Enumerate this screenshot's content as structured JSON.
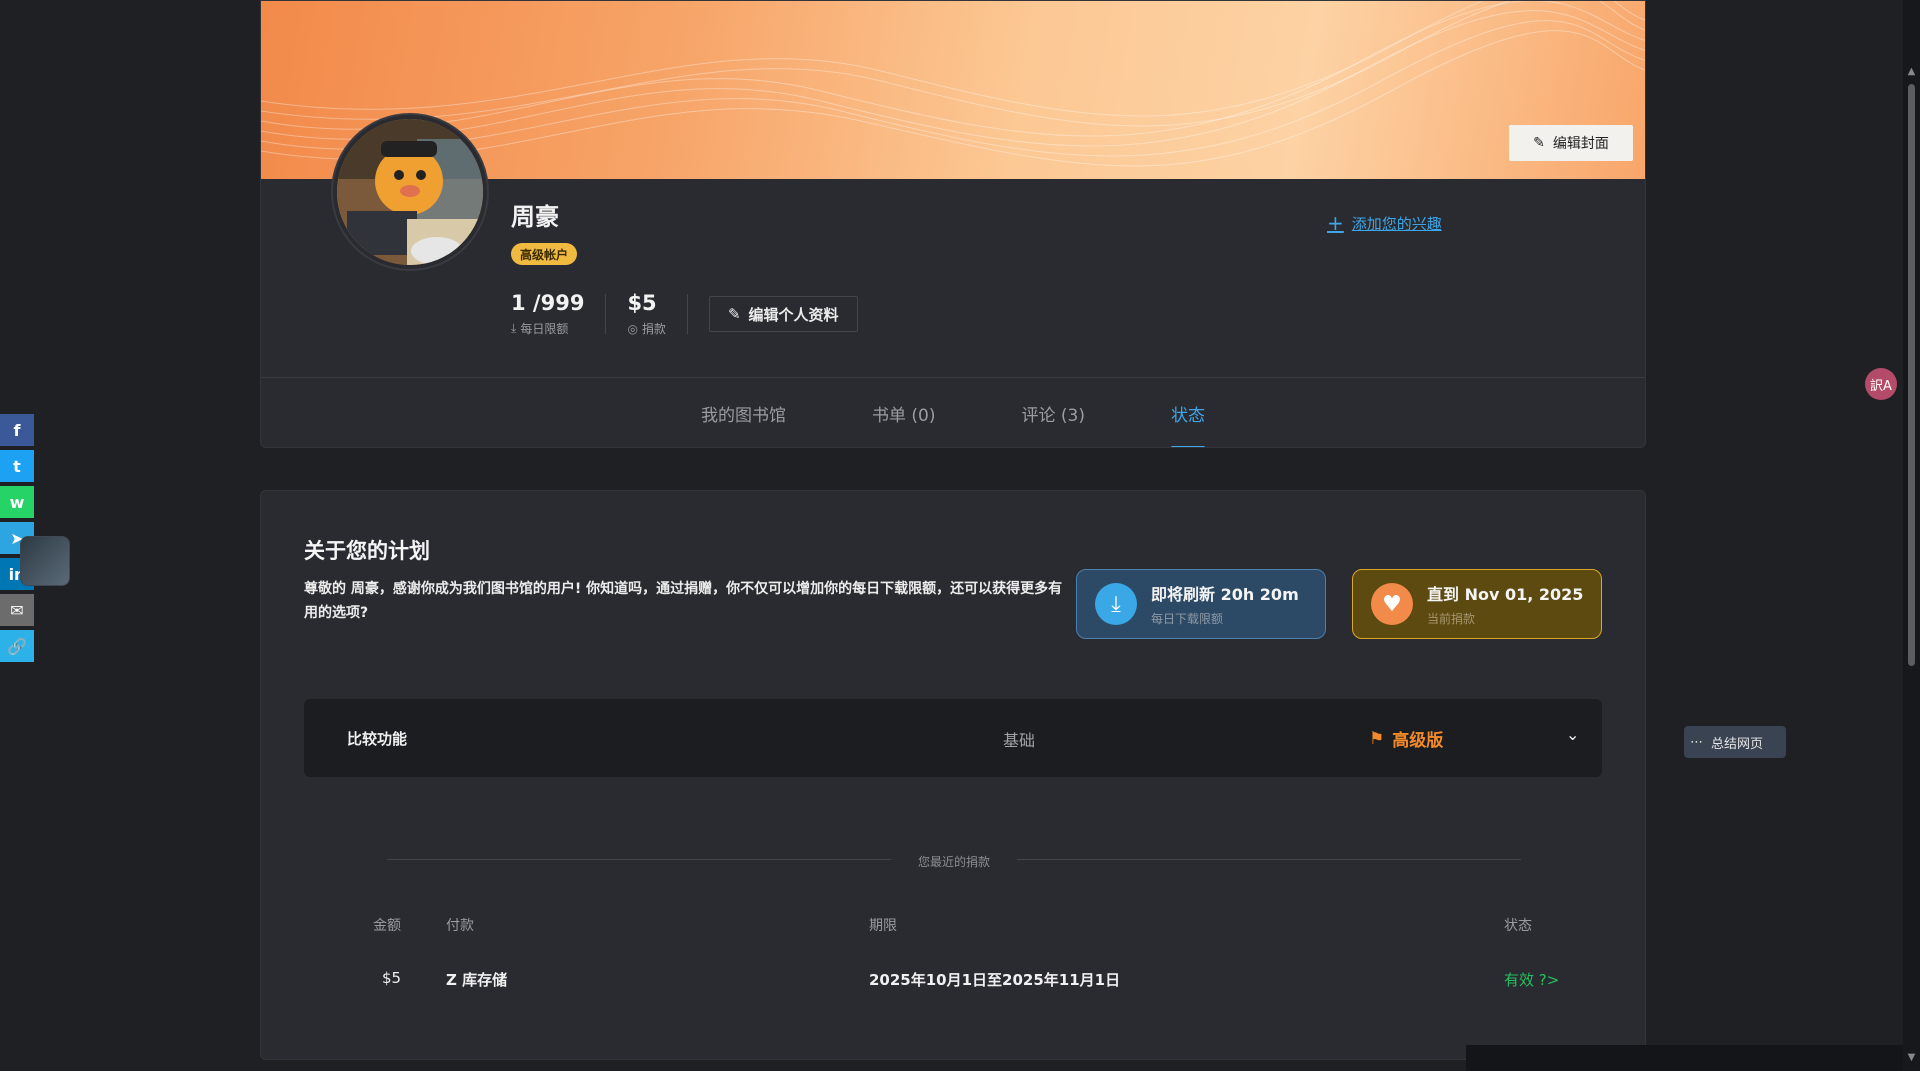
{
  "profile": {
    "name": "周豪",
    "badge": "高级帐户",
    "edit_cover": "编辑封面",
    "add_interest": "添加您的兴趣",
    "edit_profile": "编辑个人资料",
    "stats": [
      {
        "value": "1 /999",
        "label": "每日限额",
        "icon": "download-icon"
      },
      {
        "value": "$5",
        "label": "捐款",
        "icon": "coin-icon"
      }
    ]
  },
  "tabs": [
    {
      "label": "我的图书馆",
      "active": false
    },
    {
      "label": "书单 (0)",
      "active": false
    },
    {
      "label": "评论 (3)",
      "active": false
    },
    {
      "label": "状态",
      "active": true
    }
  ],
  "plan": {
    "title": "关于您的计划",
    "description": "尊敬的 周豪，感谢你成为我们图书馆的用户! 你知道吗，通过捐赠，你不仅可以增加你的每日下载限额，还可以获得更多有用的选项?",
    "refresh_box": {
      "main": "即将刷新 20h 20m",
      "sub": "每日下载限额"
    },
    "donation_box": {
      "main": "直到 Nov 01, 2025",
      "sub": "当前捐款"
    },
    "compare": {
      "label": "比较功能",
      "basic": "基础",
      "premium": "高级版"
    },
    "recent_label": "您最近的捐款",
    "table": {
      "headers": {
        "amount": "金额",
        "payment": "付款",
        "period": "期限",
        "status": "状态"
      },
      "row": {
        "amount": "$5",
        "payment": "Z 库存储",
        "period": "2025年10月1日至2025年11月1日",
        "status": "有效 ?>"
      }
    }
  },
  "widgets": {
    "summary": "总结网页",
    "translate": "訳A"
  },
  "social": [
    {
      "name": "facebook",
      "glyph": "f",
      "color": "#3b5998"
    },
    {
      "name": "twitter",
      "glyph": "t",
      "color": "#1da1f2"
    },
    {
      "name": "whatsapp",
      "glyph": "w",
      "color": "#25d366"
    },
    {
      "name": "telegram",
      "glyph": "➤",
      "color": "#2ca5e0"
    },
    {
      "name": "linkedin",
      "glyph": "in",
      "color": "#0077b5"
    },
    {
      "name": "email",
      "glyph": "✉",
      "color": "#6c6c6c"
    },
    {
      "name": "link",
      "glyph": "🔗",
      "color": "#2cb1e8"
    }
  ]
}
